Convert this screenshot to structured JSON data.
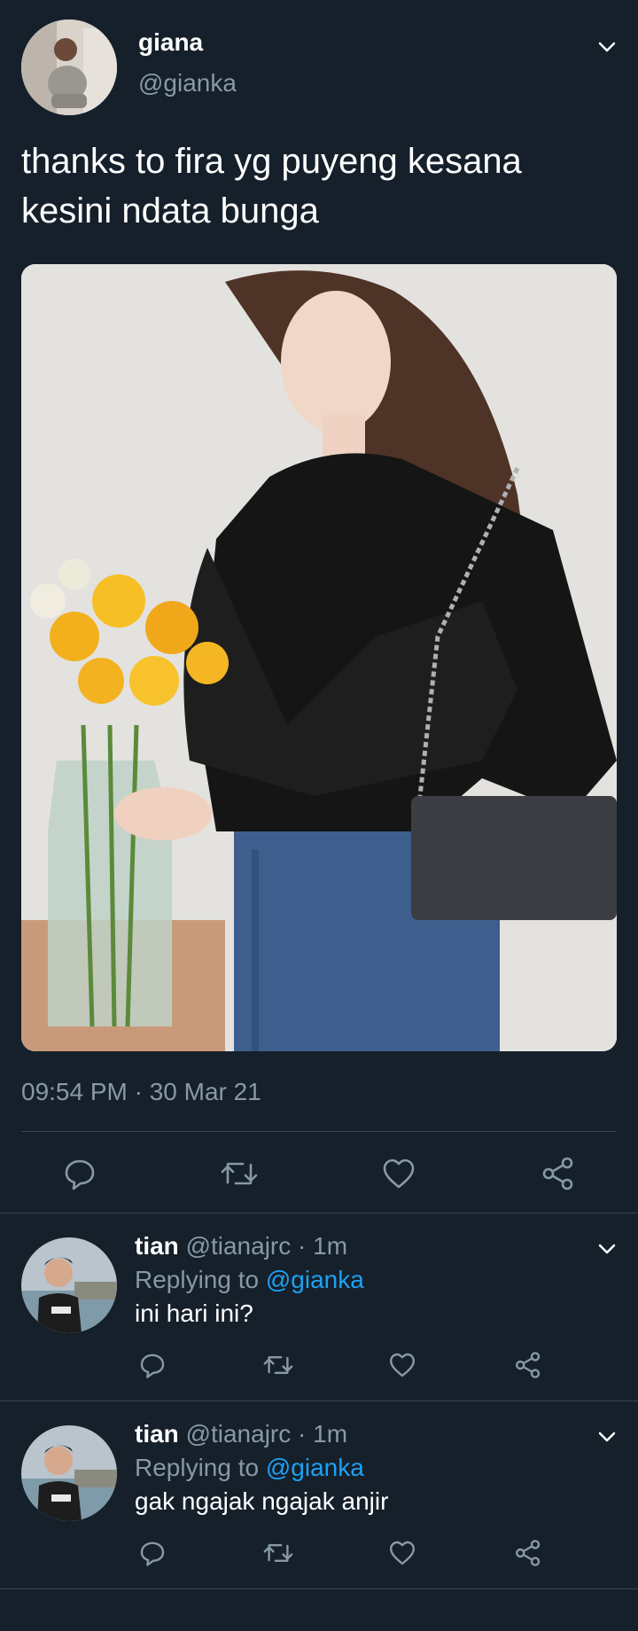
{
  "tweet": {
    "author_name": "giana",
    "author_handle": "@gianka",
    "text_line1": "thanks to fira yg puyeng kesana",
    "text_line2": "kesini ndata bunga",
    "timestamp": "09:54 PM · 30 Mar 21"
  },
  "actions": [
    "reply-icon",
    "retweet-icon",
    "like-icon",
    "share-icon"
  ],
  "replies": [
    {
      "name": "tian",
      "handle": "@tianajrc",
      "time": "· 1m",
      "replying_label": "Replying to",
      "replying_to": "@gianka",
      "text": "ini hari ini?"
    },
    {
      "name": "tian",
      "handle": "@tianajrc",
      "time": "· 1m",
      "replying_label": "Replying to",
      "replying_to": "@gianka",
      "text": "gak ngajak ngajak anjir"
    }
  ],
  "colors": {
    "background": "#15202b",
    "text": "#ffffff",
    "muted": "#8899a6",
    "link": "#1da1f2",
    "divider": "#38444d"
  }
}
